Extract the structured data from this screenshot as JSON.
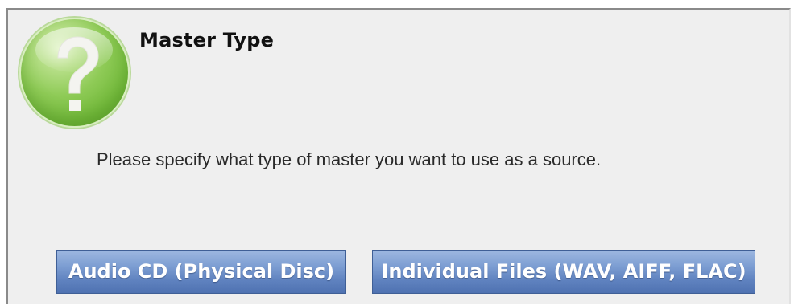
{
  "dialog": {
    "icon": "question-mark-icon",
    "title": "Master Type",
    "message": "Please specify what type of master you want to use as a source.",
    "buttons": {
      "audio_cd": "Audio CD (Physical Disc)",
      "individual_files": "Individual Files (WAV, AIFF, FLAC)"
    }
  },
  "colors": {
    "icon_green": "#72b93a",
    "button_blue": "#5f82bf",
    "dialog_background": "#efefef"
  }
}
